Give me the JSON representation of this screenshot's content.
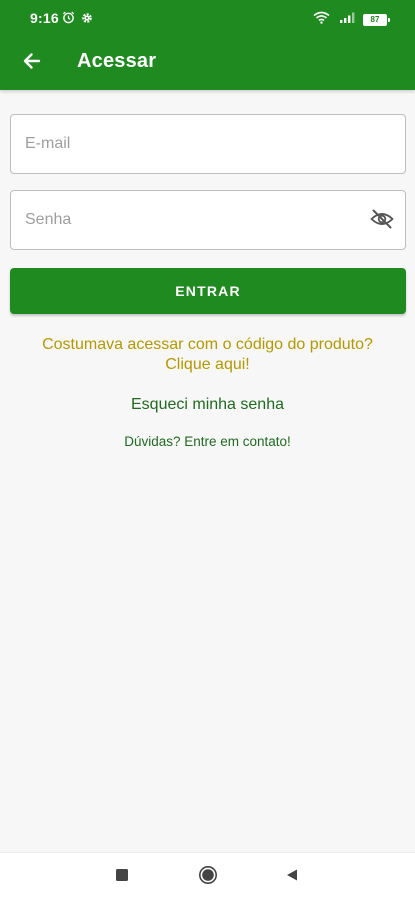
{
  "status_bar": {
    "time": "9:16",
    "battery_level": "87",
    "icons": [
      "alarm-icon",
      "settings-gear-icon",
      "wifi-icon",
      "signal-icon",
      "battery-icon"
    ]
  },
  "app_bar": {
    "title": "Acessar",
    "back_icon": "arrow-left-icon",
    "color": "#1f8a1f"
  },
  "form": {
    "email_placeholder": "E-mail",
    "email_value": "",
    "password_placeholder": "Senha",
    "password_value": "",
    "password_toggle_icon": "eye-off-icon",
    "submit_label": "ENTRAR",
    "submit_color": "#1f8a1f"
  },
  "links": {
    "product_code_line1": "Costumava acessar com o código do produto?",
    "product_code_line2": "Clique aqui!",
    "product_code_color": "#b59800",
    "forgot_password": "Esqueci minha senha",
    "contact": "Dúvidas? Entre em contato!",
    "link_color": "#1f6b1f"
  },
  "nav_bar": {
    "icons": [
      "recents-square-icon",
      "home-circle-icon",
      "back-triangle-icon"
    ]
  }
}
